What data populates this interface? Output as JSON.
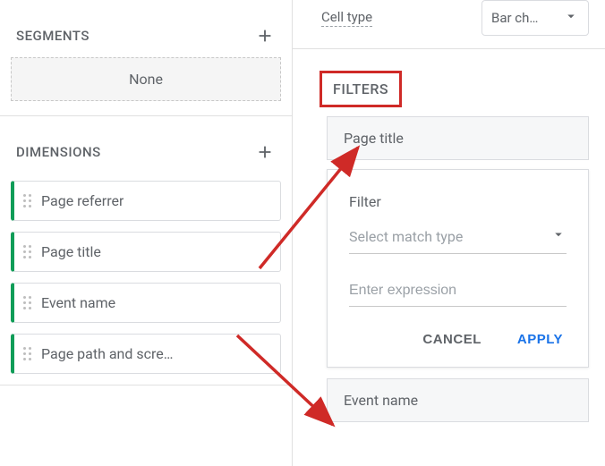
{
  "left": {
    "segments": {
      "title": "SEGMENTS",
      "none_label": "None"
    },
    "dimensions": {
      "title": "DIMENSIONS",
      "items": [
        {
          "label": "Page referrer"
        },
        {
          "label": "Page title"
        },
        {
          "label": "Event name"
        },
        {
          "label": "Page path and scre…"
        }
      ]
    }
  },
  "right": {
    "cell_type": {
      "label": "Cell type",
      "value": "Bar ch…"
    },
    "filters": {
      "title": "FILTERS",
      "chips": [
        {
          "label": "Page title"
        },
        {
          "label": "Event name"
        }
      ],
      "popup": {
        "label": "Filter",
        "match_placeholder": "Select match type",
        "expr_placeholder": "Enter expression",
        "cancel": "CANCEL",
        "apply": "APPLY"
      }
    }
  },
  "annotation": {
    "color": "#cf2a27"
  }
}
